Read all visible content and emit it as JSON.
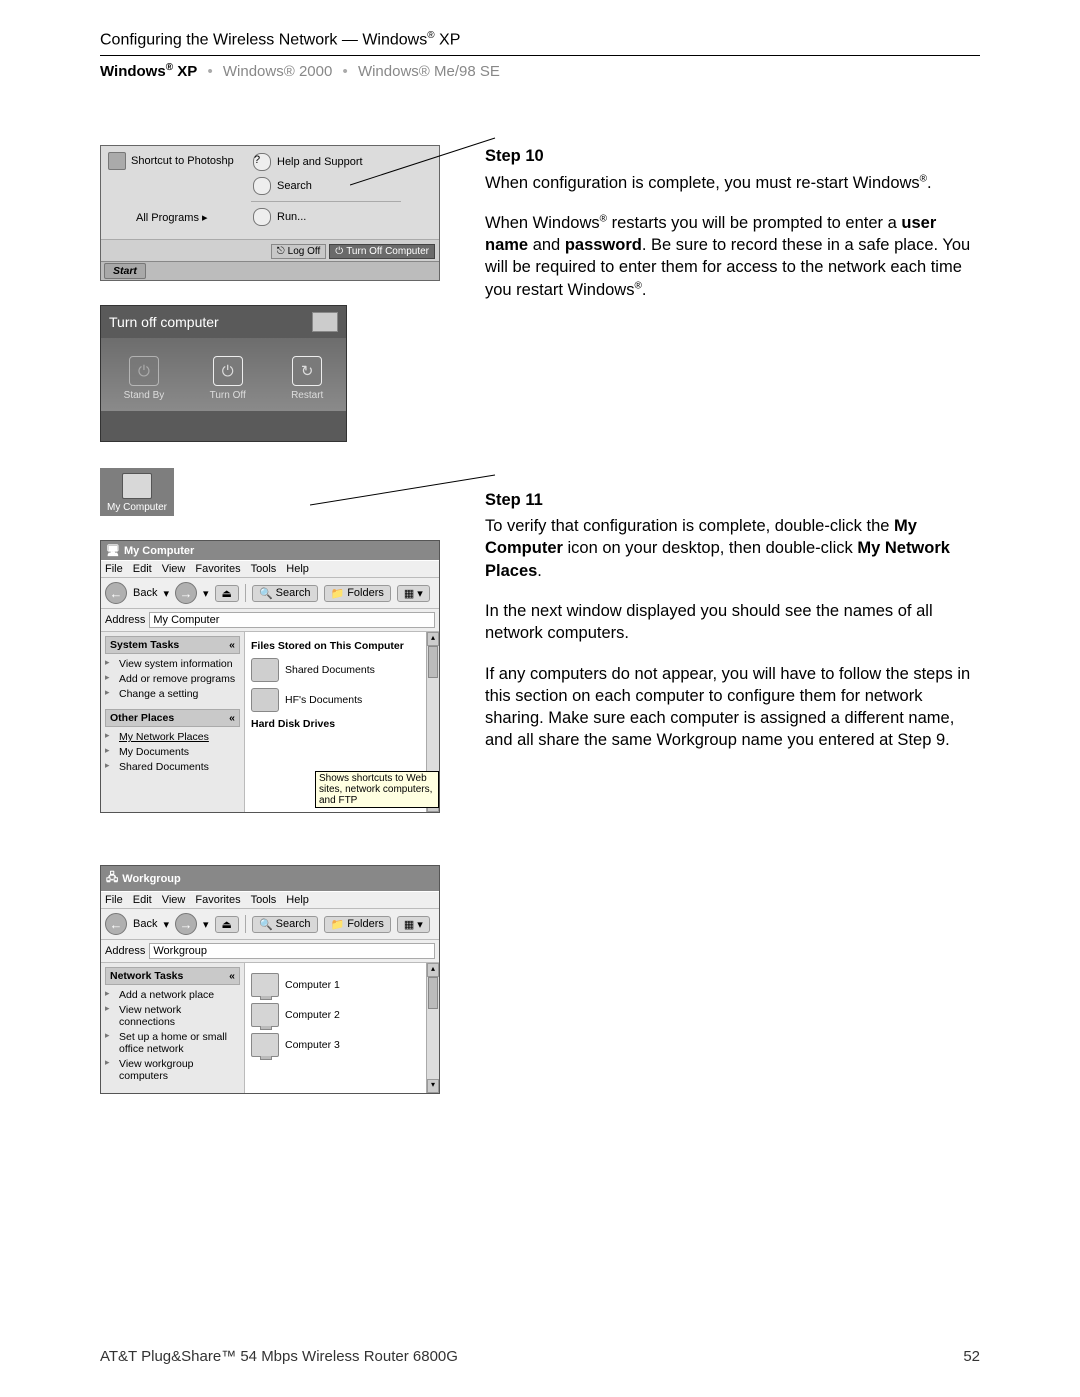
{
  "header": {
    "title_prefix": "Configuring the Wireless Network — Windows",
    "title_suffix": " XP",
    "tab_selected_prefix": "Windows",
    "tab_selected_suffix": " XP",
    "tab2": "Windows® 2000",
    "tab3": "Windows® Me/98 SE"
  },
  "start_menu": {
    "shortcut": "Shortcut to Photoshp",
    "all_programs": "All Programs   ▸",
    "help": "Help and Support",
    "search": "Search",
    "run": "Run...",
    "logoff": "Log Off",
    "turnoff": "Turn Off Computer",
    "start": "Start"
  },
  "turnoff": {
    "title": "Turn off computer",
    "standby": "Stand By",
    "off": "Turn Off",
    "restart": "Restart"
  },
  "desktop_icon": "My Computer",
  "mycomputer": {
    "title": "My Computer",
    "menus": [
      "File",
      "Edit",
      "View",
      "Favorites",
      "Tools",
      "Help"
    ],
    "back": "Back",
    "search": "Search",
    "folders": "Folders",
    "addr_label": "Address",
    "addr_value": "My Computer",
    "tasks_hd": "System Tasks",
    "tasks": [
      "View system information",
      "Add or remove programs",
      "Change a setting"
    ],
    "other_hd": "Other Places",
    "other": [
      "My Network Places",
      "My Documents",
      "Shared Documents"
    ],
    "sec1": "Files Stored on This Computer",
    "sec1_items": [
      "Shared Documents",
      "HF's Documents"
    ],
    "sec2": "Hard Disk Drives",
    "tooltip": "Shows shortcuts to Web sites, network computers, and FTP"
  },
  "workgroup": {
    "title": "Workgroup",
    "menus": [
      "File",
      "Edit",
      "View",
      "Favorites",
      "Tools",
      "Help"
    ],
    "back": "Back",
    "search": "Search",
    "folders": "Folders",
    "addr_label": "Address",
    "addr_value": "Workgroup",
    "tasks_hd": "Network Tasks",
    "tasks": [
      "Add a network place",
      "View network connections",
      "Set up a home or small office network",
      "View workgroup computers"
    ],
    "computers": [
      "Computer 1",
      "Computer 2",
      "Computer 3"
    ]
  },
  "step10": {
    "hd": "Step 10",
    "p1a": "When configuration is complete, you must re-start Windows",
    "p1b": ".",
    "p2a": "When Windows",
    "p2b": " restarts you will be prompted to enter a ",
    "p2c": "user name",
    "p2d": " and ",
    "p2e": "password",
    "p2f": ". Be sure to record these in a safe place. You will be required to enter them for access to the network each time you restart Windows",
    "p2g": "."
  },
  "step11": {
    "hd": "Step 11",
    "p1a": "To verify that configuration is complete, double-click the ",
    "p1b": "My Computer",
    "p1c": " icon on your desktop, then double-click ",
    "p1d": "My Network Places",
    "p1e": ".",
    "p2": "In the next window displayed you should see the names of all network computers.",
    "p3": "If any computers do not appear, you will have to follow the steps in this section on each computer to configure them for network sharing. Make sure each computer is assigned a different name, and all share the same Workgroup name you entered at Step 9."
  },
  "footer": {
    "left": "AT&T Plug&Share™ 54 Mbps Wireless Router 6800G",
    "right": "52"
  },
  "glyph": {
    "reg": "®",
    "chev": "«",
    "arrL": "←",
    "arrR": "→",
    "up": "⏏",
    "mag": "🔍",
    "fold": "📁",
    "pow": "⏻",
    "res": "↻",
    "tri": "▾",
    "triU": "▴"
  }
}
